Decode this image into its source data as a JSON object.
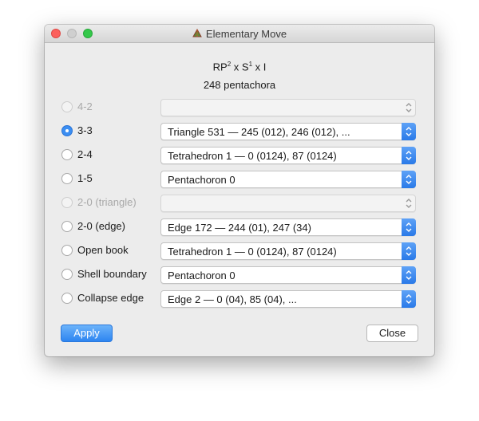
{
  "window": {
    "title": "Elementary Move"
  },
  "header": {
    "manifold_base": "RP",
    "sup1": "2",
    "mid": " x S",
    "sup2": "1",
    "tail": " x I",
    "size": "248 pentachora"
  },
  "moves": [
    {
      "label": "4-2",
      "enabled": false,
      "checked": false,
      "option": ""
    },
    {
      "label": "3-3",
      "enabled": true,
      "checked": true,
      "option": "Triangle 531 — 245 (012), 246 (012), ..."
    },
    {
      "label": "2-4",
      "enabled": true,
      "checked": false,
      "option": "Tetrahedron 1 — 0 (0124), 87 (0124)"
    },
    {
      "label": "1-5",
      "enabled": true,
      "checked": false,
      "option": "Pentachoron 0"
    },
    {
      "label": "2-0 (triangle)",
      "enabled": false,
      "checked": false,
      "option": ""
    },
    {
      "label": "2-0 (edge)",
      "enabled": true,
      "checked": false,
      "option": "Edge 172 — 244 (01), 247 (34)"
    },
    {
      "label": "Open book",
      "enabled": true,
      "checked": false,
      "option": "Tetrahedron 1 — 0 (0124), 87 (0124)"
    },
    {
      "label": "Shell boundary",
      "enabled": true,
      "checked": false,
      "option": "Pentachoron 0"
    },
    {
      "label": "Collapse edge",
      "enabled": true,
      "checked": false,
      "option": "Edge 2 — 0 (04), 85 (04), ..."
    }
  ],
  "buttons": {
    "apply": "Apply",
    "close": "Close"
  }
}
